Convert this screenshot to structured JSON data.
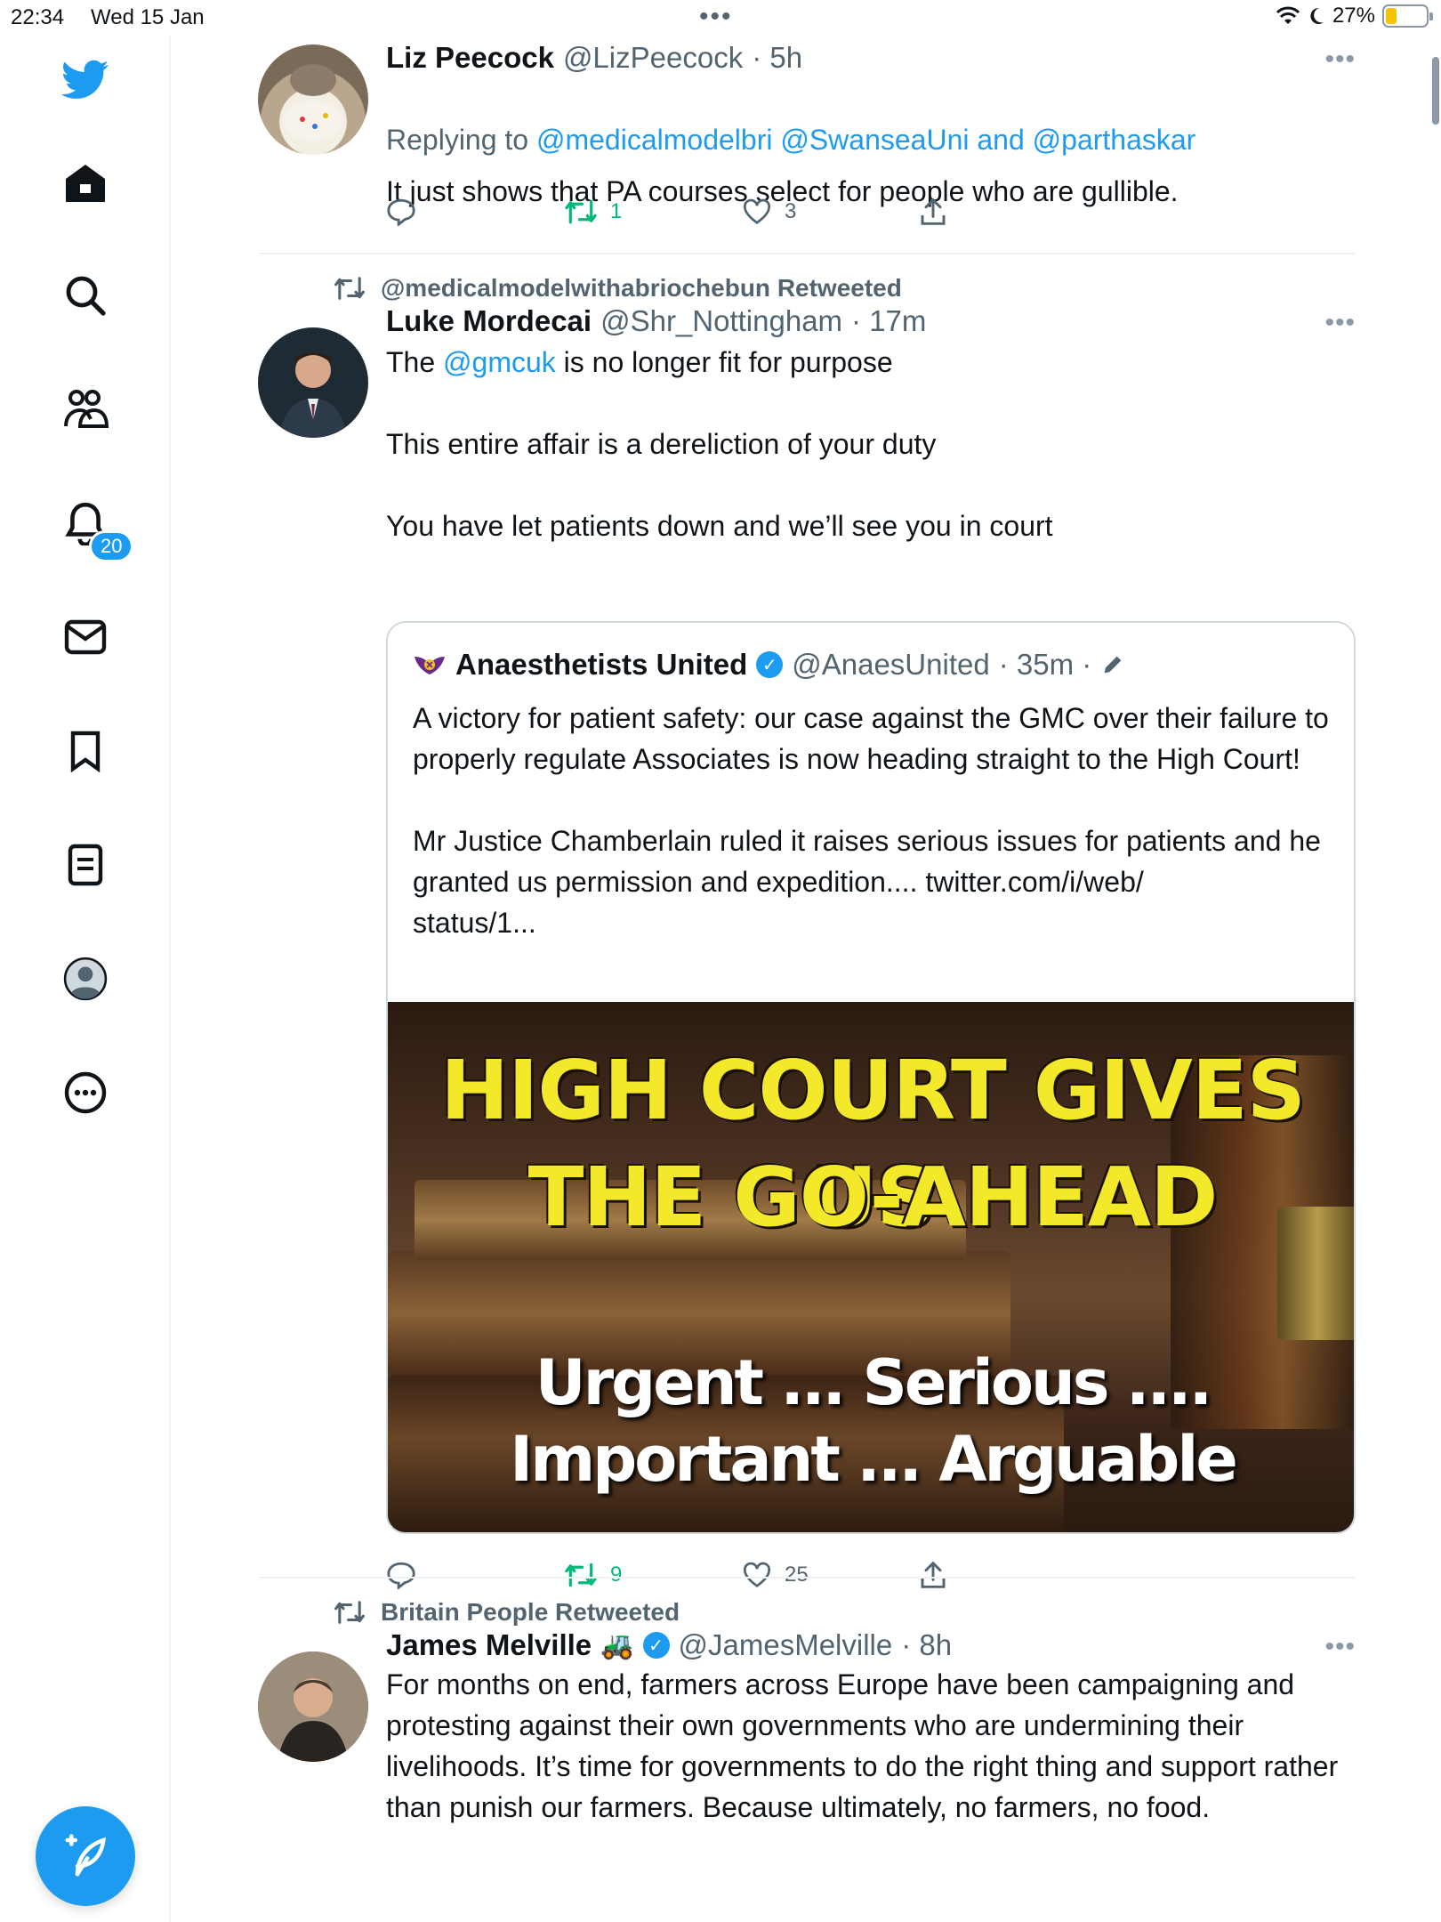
{
  "status_bar": {
    "time": "22:34",
    "date": "Wed 15 Jan",
    "battery": "27%",
    "battery_level": 0.27
  },
  "sidebar": {
    "items": [
      {
        "icon": "twitter-bird-icon"
      },
      {
        "icon": "home-icon"
      },
      {
        "icon": "search-icon"
      },
      {
        "icon": "communities-icon"
      },
      {
        "icon": "notifications-icon",
        "badge": "20"
      },
      {
        "icon": "messages-icon"
      },
      {
        "icon": "bookmarks-icon"
      },
      {
        "icon": "lists-icon"
      },
      {
        "icon": "profile-icon"
      },
      {
        "icon": "more-icon"
      }
    ],
    "compose": "compose-tweet-icon"
  },
  "tweets": [
    {
      "name": "Liz Peecock",
      "handle": "@LizPeecock",
      "time": "· 5h",
      "replying_prefix": "Replying to ",
      "replying_to": "@medicalmodelbri @SwanseaUni and @parthaskar",
      "text": "It just shows that PA courses select for people who are gullible.",
      "actions": {
        "replies": "",
        "retweets": "1",
        "likes": "3"
      }
    },
    {
      "retweeted_by": "@medicalmodelwithabriochebun Retweeted",
      "name": "Luke Mordecai",
      "handle": "@Shr_Nottingham",
      "time": "· 17m",
      "text_pre": "The ",
      "text_link": "@gmcuk",
      "text_post": " is no longer fit for purpose",
      "text_rest": "This entire affair is a dereliction of your duty\n\nYou have let patients down and we’ll see you in court",
      "quote": {
        "name": "Anaesthetists United",
        "handle": "@AnaesUnited",
        "time": "· 35m ·",
        "text": "A victory for patient safety: our case against the GMC over their failure to properly regulate Associates is now heading straight to the High Court!\n\nMr Justice Chamberlain ruled it raises serious issues for patients and he granted us permission and expedition.... twitter.com/i/web/\nstatus/1...",
        "image": {
          "headline_1": "HIGH COURT GIVES US",
          "headline_2": "THE GO-AHEAD",
          "sub_1": "Urgent ... Serious ....",
          "sub_2": "Important ... Arguable"
        }
      },
      "actions": {
        "replies": "",
        "retweets": "9",
        "likes": "25"
      }
    },
    {
      "retweeted_by": "Britain People Retweeted",
      "name": "James Melville",
      "name_emoji": "🚜",
      "handle": "@JamesMelville",
      "time": "· 8h",
      "text": "For months on end, farmers across Europe have been campaigning and protesting against their own governments who are undermining their livelihoods. It’s time for governments to do the right thing and support rather than punish our farmers. Because ultimately, no farmers, no food."
    }
  ],
  "more_label": "•••"
}
